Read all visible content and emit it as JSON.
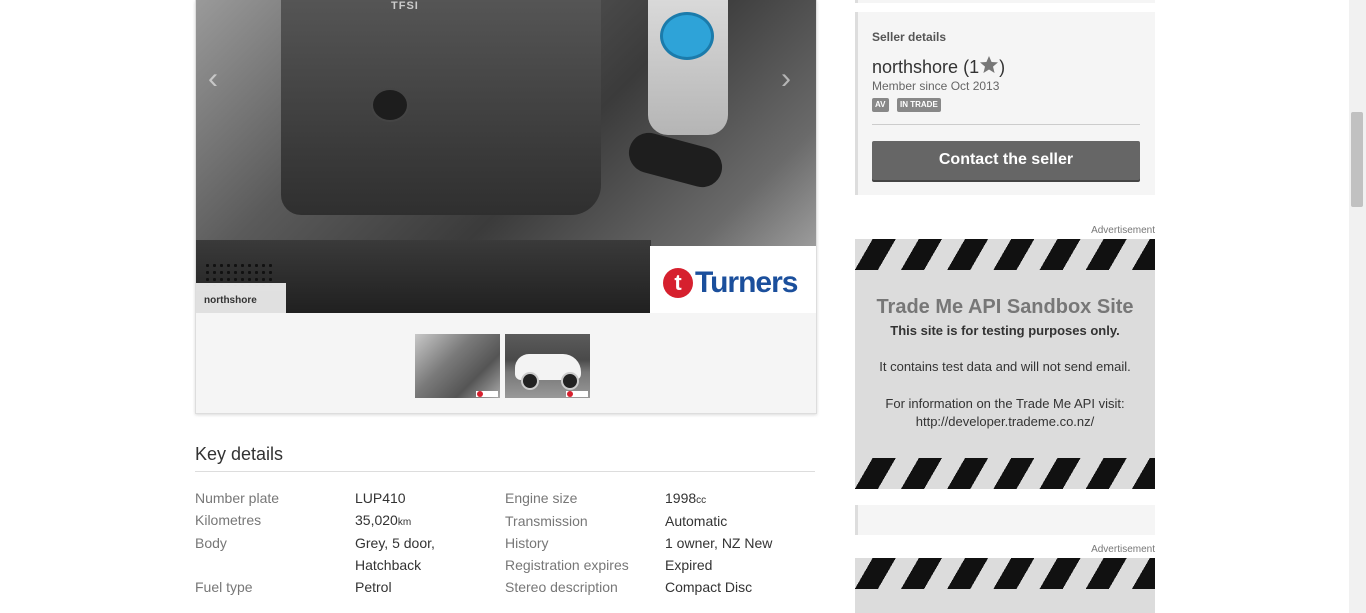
{
  "gallery": {
    "watermark_user": "northshore",
    "engine_label": "TFSI",
    "dealer_logo_text": "Turners",
    "dealer_logo_mark": "t",
    "prev_arrow": "‹",
    "next_arrow": "›",
    "thumbnails": [
      {
        "name": "engine-bay"
      },
      {
        "name": "white-audi-sedan"
      }
    ]
  },
  "key_details": {
    "title": "Key details",
    "left_rows": [
      {
        "label": "Number plate",
        "value": "LUP410"
      },
      {
        "label": "Kilometres",
        "value": "35,020",
        "unit": "km"
      },
      {
        "label": "Body",
        "value": "Grey, 5 door,",
        "value2": "Hatchback"
      },
      {
        "label": "Fuel type",
        "value": "Petrol"
      }
    ],
    "right_rows": [
      {
        "label": "Engine size",
        "value": "1998",
        "unit": "cc"
      },
      {
        "label": "Transmission",
        "value": "Automatic"
      },
      {
        "label": "History",
        "value": "1 owner, NZ New"
      },
      {
        "label": "Registration expires",
        "value": "Expired"
      },
      {
        "label": "Stereo description",
        "value": "Compact Disc"
      }
    ]
  },
  "seller": {
    "heading": "Seller details",
    "name": "northshore",
    "rating_open": "(1",
    "rating_close": ")",
    "member_since": "Member since Oct 2013",
    "badges": [
      "AV",
      "IN TRADE"
    ],
    "contact_label": "Contact the seller"
  },
  "ads": {
    "label": "Advertisement",
    "title": "Trade Me API Sandbox Site",
    "line1": "This site is for testing purposes only.",
    "line2": "It contains test data and will not send email.",
    "line3": "For information on the Trade Me API visit:",
    "line4": "http://developer.trademe.co.nz/"
  },
  "colors": {
    "accent_blue": "#2ea3d8",
    "turners_red": "#d6202e",
    "turners_blue": "#1b4f9c",
    "button_gray": "#666666"
  }
}
